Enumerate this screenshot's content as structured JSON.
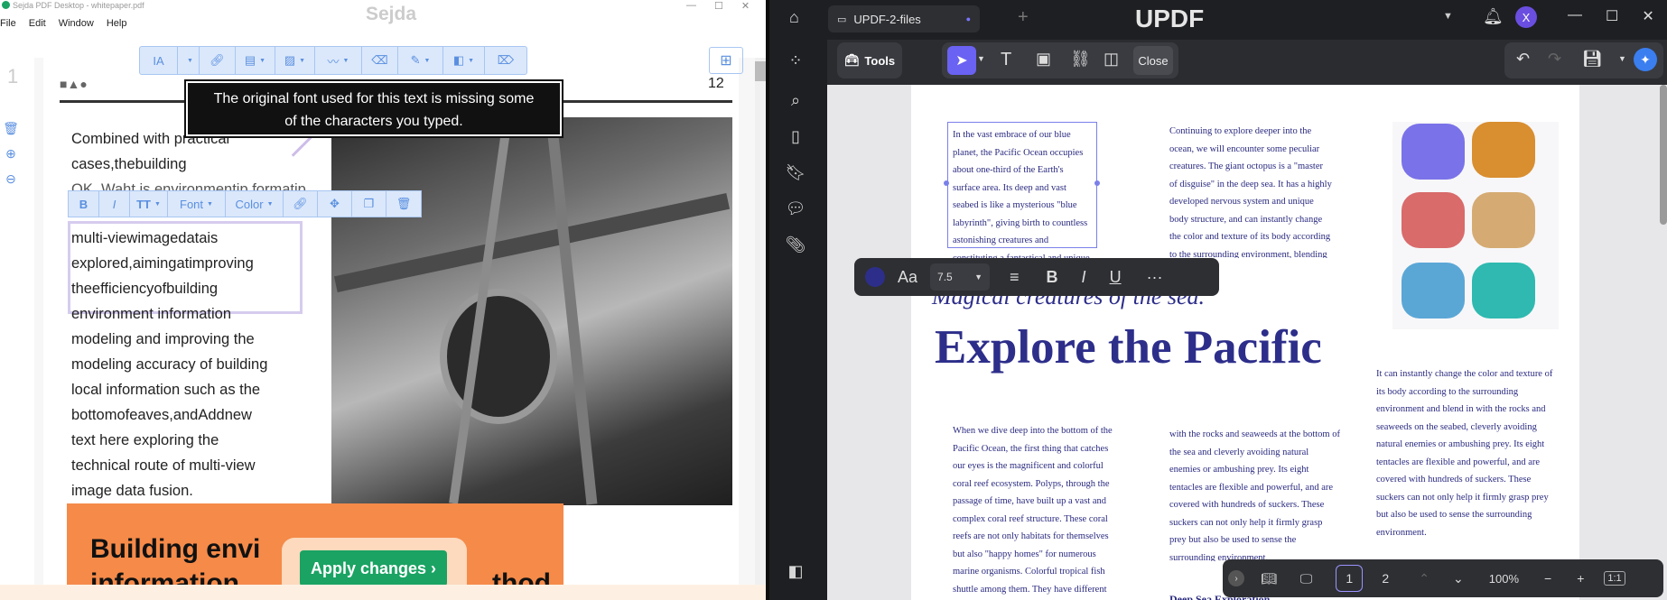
{
  "sejda": {
    "title": "Sejda PDF Desktop - whitepaper.pdf",
    "watermark": "Sejda",
    "menu": [
      "File",
      "Edit",
      "Window",
      "Help"
    ],
    "page_number_left": "1",
    "page_number_right": "12",
    "toolbar": {
      "text_tool_label": "IA",
      "items": [
        "text-tool",
        "link-icon",
        "form-icon",
        "image-icon",
        "signature-icon",
        "eraser-icon",
        "pen-icon",
        "shapes-icon",
        "delete-icon"
      ]
    },
    "tooltip": {
      "line1": "The original font used for this text is missing some",
      "line2": "of the characters you typed."
    },
    "text_toolbar": {
      "bold": "B",
      "italic": "I",
      "size": "TT",
      "font": "Font",
      "color": "Color"
    },
    "paragraph_lines": [
      "Combined with practical",
      "cases,thebuilding",
      "OK. Waht is environmentip formatip",
      "multi-viewimagedatais",
      "explored,aimingatimproving",
      "theefficiencyofbuilding",
      "environment information",
      "modeling and improving the",
      "modeling accuracy of building",
      "local information such as the",
      "bottomofeaves,andAddnew",
      "text  here exploring the",
      "technical route of multi-view",
      "image data fusion."
    ],
    "heading_partial": "Building envi",
    "heading_partial2": "information",
    "heading_partial3": "thod",
    "apply_button": "Apply changes ›"
  },
  "updf": {
    "tab_title": "UPDF-2-files",
    "brand": "UPDF",
    "avatar_letter": "X",
    "tools_label": "Tools",
    "close_label": "Close",
    "col1_selected": "In the vast embrace of our blue planet, the Pacific Ocean occupies about one-third of the Earth's surface area. Its deep and vast seabed is like a mysterious \"blue labyrinth\", giving birth to countless astonishing creatures and constituting a fantastical and unique ecosystem.",
    "col2_top": "Continuing to explore deeper into the ocean, we will encounter some peculiar creatures. The giant octopus is a \"master of disguise\" in the deep sea. It has a highly developed nervous system and unique body structure, and can instantly change the color and texture of its body according to the surrounding environment, blending in",
    "subtitle": "Magical creatures of the sea.",
    "title": "Explore the Pacific",
    "col_right": "It can instantly change the color and texture of its body according to the surrounding environment and blend in with the rocks and seaweeds on the seabed, cleverly avoiding natural enemies or ambushing prey. Its eight tentacles are flexible and powerful, and are covered with hundreds of suckers. These suckers can not only help it firmly grasp prey but also be used to sense the surrounding environment.",
    "col_b1": "When we dive deep into the bottom of the Pacific Ocean, the first thing that catches our eyes is the magnificent and colorful coral reef ecosystem. Polyps, through the passage of time, have built up a vast and complex coral reef structure. These coral reefs are not only habitats for themselves but also \"happy homes\" for numerous marine organisms. Colorful tropical fish shuttle among them. They have different",
    "col_b2": "with the rocks and seaweeds at the bottom of the sea and cleverly avoiding natural enemies or ambushing prey. Its eight tentacles are flexible and powerful, and are covered with hundreds of suckers. These suckers can not only help it firmly grasp prey but also be used to sense the surrounding environment.",
    "col_b2_tail": "Deep Sea Exploration",
    "format": {
      "font_size": "7.5",
      "aa": "Aa",
      "bold": "B",
      "italic": "I",
      "underline": "U",
      "more": "···"
    },
    "pages": [
      "1",
      "2"
    ],
    "zoom": "100%",
    "fit": "1:1"
  }
}
